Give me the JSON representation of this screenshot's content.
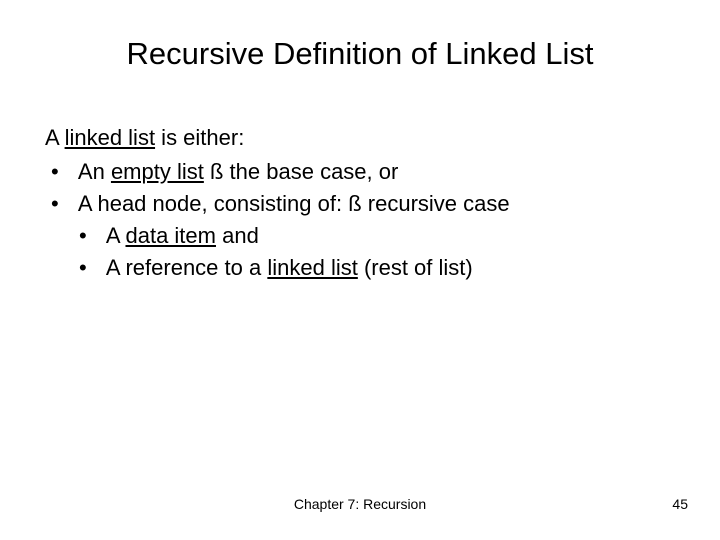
{
  "title": "Recursive Definition of Linked List",
  "intro_pre": "A ",
  "intro_u": "linked list",
  "intro_post": " is either:",
  "b1_pre": "An ",
  "b1_u": "empty list",
  "b1_post": "   ",
  "b1_arrow": "ß",
  "b1_tail": "  the base case, or",
  "b2_pre": "A head node, consisting of:  ",
  "b2_arrow": "ß",
  "b2_tail": "   recursive case",
  "b3_pre": "A ",
  "b3_u": "data item",
  "b3_post": " and",
  "b4_pre": "A reference to a ",
  "b4_u": "linked list",
  "b4_post": " (rest of list)",
  "footer_center": "Chapter 7: Recursion",
  "footer_right": "45"
}
